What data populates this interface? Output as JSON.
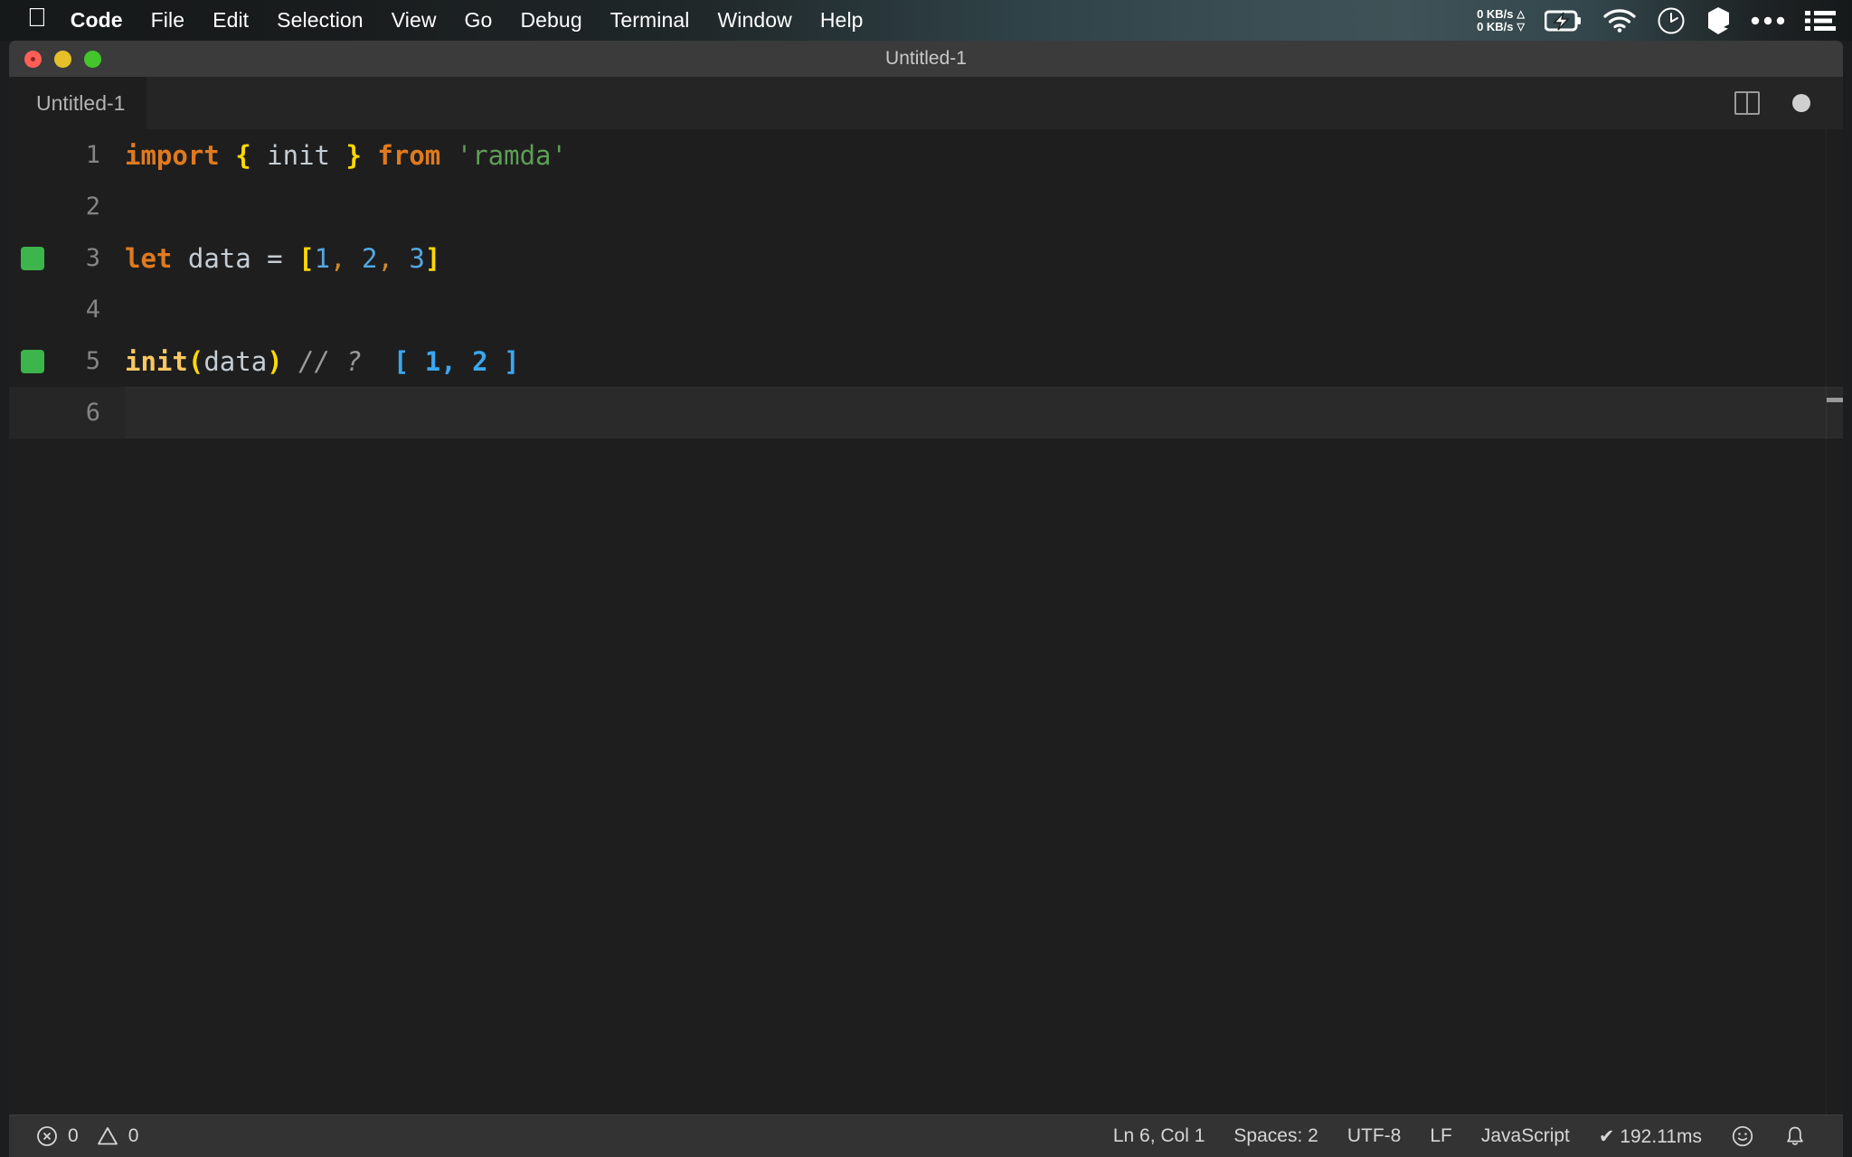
{
  "menubar": {
    "apple_icon": "apple-logo",
    "items": [
      {
        "label": "Code",
        "bold": true
      },
      {
        "label": "File",
        "bold": false
      },
      {
        "label": "Edit",
        "bold": false
      },
      {
        "label": "Selection",
        "bold": false
      },
      {
        "label": "View",
        "bold": false
      },
      {
        "label": "Go",
        "bold": false
      },
      {
        "label": "Debug",
        "bold": false
      },
      {
        "label": "Terminal",
        "bold": false
      },
      {
        "label": "Window",
        "bold": false
      },
      {
        "label": "Help",
        "bold": false
      }
    ],
    "network": {
      "upload": "0 KB/s",
      "download": "0 KB/s",
      "up_arrow": "△",
      "down_arrow": "▽"
    },
    "status_icons": [
      "battery-charging-icon",
      "wifi-icon",
      "clock-icon",
      "cube-icon",
      "ellipsis-icon",
      "list-menu-icon"
    ]
  },
  "window": {
    "title": "Untitled-1",
    "traffic_lights": [
      "close-button",
      "minimize-button",
      "maximize-button"
    ]
  },
  "tabbar": {
    "tabs": [
      {
        "label": "Untitled-1",
        "active": true,
        "dirty": true
      }
    ],
    "actions": [
      "split-editor-icon",
      "unsaved-dot-icon"
    ]
  },
  "editor": {
    "lines": [
      {
        "number": "1",
        "quokka": false,
        "active": false,
        "tokens": [
          {
            "text": "import",
            "cls": "kw"
          },
          {
            "text": " ",
            "cls": "ident"
          },
          {
            "text": "{",
            "cls": "brace"
          },
          {
            "text": " ",
            "cls": "ident"
          },
          {
            "text": "init",
            "cls": "ident"
          },
          {
            "text": " ",
            "cls": "ident"
          },
          {
            "text": "}",
            "cls": "brace"
          },
          {
            "text": " ",
            "cls": "ident"
          },
          {
            "text": "from",
            "cls": "kw"
          },
          {
            "text": " ",
            "cls": "ident"
          },
          {
            "text": "'ramda'",
            "cls": "str"
          }
        ]
      },
      {
        "number": "2",
        "quokka": false,
        "active": false,
        "tokens": []
      },
      {
        "number": "3",
        "quokka": true,
        "active": false,
        "tokens": [
          {
            "text": "let",
            "cls": "kw"
          },
          {
            "text": " ",
            "cls": "ident"
          },
          {
            "text": "data",
            "cls": "ident"
          },
          {
            "text": " ",
            "cls": "ident"
          },
          {
            "text": "=",
            "cls": "eq"
          },
          {
            "text": " ",
            "cls": "ident"
          },
          {
            "text": "[",
            "cls": "brace"
          },
          {
            "text": "1",
            "cls": "num"
          },
          {
            "text": ",",
            "cls": "punct"
          },
          {
            "text": " ",
            "cls": "ident"
          },
          {
            "text": "2",
            "cls": "num"
          },
          {
            "text": ",",
            "cls": "punct"
          },
          {
            "text": " ",
            "cls": "ident"
          },
          {
            "text": "3",
            "cls": "num"
          },
          {
            "text": "]",
            "cls": "brace"
          }
        ]
      },
      {
        "number": "4",
        "quokka": false,
        "active": false,
        "tokens": []
      },
      {
        "number": "5",
        "quokka": true,
        "active": false,
        "tokens": [
          {
            "text": "init",
            "cls": "fn"
          },
          {
            "text": "(",
            "cls": "brace"
          },
          {
            "text": "data",
            "cls": "ident"
          },
          {
            "text": ")",
            "cls": "brace"
          },
          {
            "text": " ",
            "cls": "ident"
          },
          {
            "text": "// ?",
            "cls": "comment"
          },
          {
            "text": "  ",
            "cls": "ident"
          },
          {
            "text": "[ 1, 2 ]",
            "cls": "result"
          }
        ]
      },
      {
        "number": "6",
        "quokka": false,
        "active": true,
        "tokens": []
      }
    ]
  },
  "statusbar": {
    "errors": "0",
    "warnings": "0",
    "error_icon": "error-circle-icon",
    "warning_icon": "warning-triangle-icon",
    "right_items": [
      {
        "label": "Ln 6, Col 1",
        "name": "cursor-position"
      },
      {
        "label": "Spaces: 2",
        "name": "indentation"
      },
      {
        "label": "UTF-8",
        "name": "encoding"
      },
      {
        "label": "LF",
        "name": "eol-sequence"
      },
      {
        "label": "JavaScript",
        "name": "language-mode"
      },
      {
        "label": "✔ 192.11ms",
        "name": "quokka-runtime"
      }
    ],
    "feedback_icon": "smiley-icon",
    "notifications_icon": "bell-icon"
  },
  "colors": {
    "accent_green": "#3cb54a",
    "keyword": "#e07a1f",
    "string": "#5d9e55",
    "number": "#54a7e0",
    "brace": "#ffd900",
    "editor_bg": "#1e1e1e",
    "statusbar_bg": "#333333"
  }
}
